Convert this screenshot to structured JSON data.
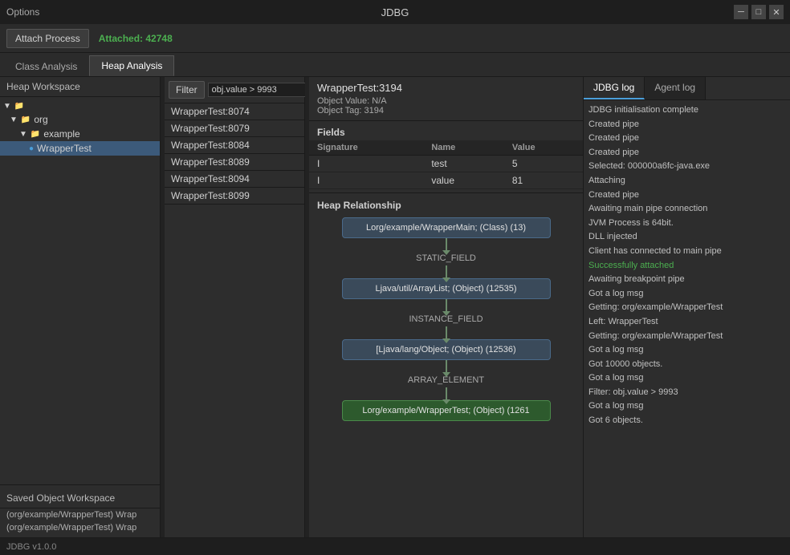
{
  "titleBar": {
    "menuItem": "Options",
    "appTitle": "JDBG",
    "minBtn": "─",
    "maxBtn": "□",
    "closeBtn": "✕"
  },
  "toolbar": {
    "attachBtnLabel": "Attach Process",
    "attachedLabel": "Attached: 42748"
  },
  "tabs": {
    "classAnalysis": "Class Analysis",
    "heapAnalysis": "Heap Analysis"
  },
  "leftPanel": {
    "workspaceTitle": "Heap Workspace",
    "tree": [
      {
        "label": "org",
        "level": 1,
        "type": "folder",
        "expanded": true
      },
      {
        "label": "example",
        "level": 2,
        "type": "folder",
        "expanded": true
      },
      {
        "label": "WrapperTest",
        "level": 3,
        "type": "class"
      }
    ],
    "savedTitle": "Saved Object Workspace",
    "savedItems": [
      "(org/example/WrapperTest) Wrap",
      "(org/example/WrapperTest) Wrap"
    ]
  },
  "middlePanel": {
    "filterBtnLabel": "Filter",
    "filterValue": "obj.value > 9993",
    "objects": [
      "WrapperTest:8074",
      "WrapperTest:8079",
      "WrapperTest:8084",
      "WrapperTest:8089",
      "WrapperTest:8094",
      "WrapperTest:8099"
    ]
  },
  "centerPanel": {
    "objectTitle": "WrapperTest:3194",
    "objectValue": "Object Value: N/A",
    "objectTag": "Object Tag: 3194",
    "fieldsLabel": "Fields",
    "fields": {
      "headers": [
        "Signature",
        "Name",
        "Value"
      ],
      "rows": [
        {
          "sig": "I",
          "name": "test",
          "value": "5"
        },
        {
          "sig": "I",
          "name": "value",
          "value": "81"
        }
      ]
    },
    "heapRelLabel": "Heap Relationship",
    "heapNodes": [
      {
        "label": "Lorg/example/WrapperMain; (Class) (13)",
        "type": "normal"
      },
      {
        "edgeLabel": "STATIC_FIELD"
      },
      {
        "label": "Ljava/util/ArrayList; (Object) (12535)",
        "type": "normal"
      },
      {
        "edgeLabel": "INSTANCE_FIELD"
      },
      {
        "label": "[Ljava/lang/Object; (Object) (12536)",
        "type": "normal"
      },
      {
        "edgeLabel": "ARRAY_ELEMENT"
      },
      {
        "label": "Lorg/example/WrapperTest; (Object) (1261",
        "type": "green"
      }
    ]
  },
  "rightPanel": {
    "tabs": [
      "JDBG log",
      "Agent log"
    ],
    "activeTab": "JDBG log",
    "logLines": [
      "JDBG initialisation complete",
      "Created pipe",
      "Created pipe",
      "Created pipe",
      "Selected: 000000a6fc-java.exe",
      "Attaching",
      "Created pipe",
      "Awaiting main pipe connection",
      "JVM Process is 64bit.",
      "DLL injected",
      "Client has connected to main pipe",
      "Successfully attached",
      "Awaiting breakpoint pipe",
      "Got a log msg",
      "Getting: org/example/WrapperTest",
      "Left: WrapperTest",
      "Getting: org/example/WrapperTest",
      "Got a log msg",
      "Got 10000 objects.",
      "Got a log msg",
      "Filter: obj.value > 9993",
      "Got a log msg",
      "Got 6 objects."
    ]
  },
  "statusBar": {
    "label": "JDBG v1.0.0"
  }
}
